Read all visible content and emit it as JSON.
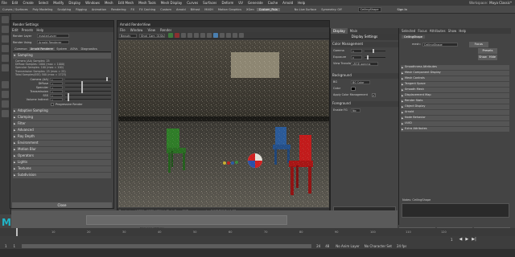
{
  "menubar": {
    "items": [
      "File",
      "Edit",
      "Create",
      "Select",
      "Modify",
      "Display",
      "Windows",
      "Mesh",
      "Edit Mesh",
      "Mesh Tools",
      "Mesh Display",
      "Curves",
      "Surfaces",
      "Deform",
      "UV",
      "Generate",
      "Cache",
      "Arnold",
      "Help"
    ],
    "object_field": "CeilingShape",
    "sign_in": "Sign In",
    "workspace_label": "Workspace:",
    "workspace_value": "Maya Classic*"
  },
  "shelf": {
    "tabs": [
      "Curves / Surfaces",
      "Poly Modeling",
      "Sculpting",
      "Rigging",
      "Animation",
      "Rendering",
      "FX",
      "FX Caching",
      "Custom",
      "Arnold",
      "Bifrost",
      "MASH",
      "Motion Graphics",
      "XGen",
      "Custom_Pola"
    ],
    "active_tab": "Custom_Pola",
    "live_surface": "No Live Surface",
    "symmetry": "Symmetry: Off"
  },
  "render_settings": {
    "title": "Render Settings",
    "menu": [
      "Edit",
      "Presets",
      "Help"
    ],
    "render_layer_label": "Render Layer",
    "render_layer_value": "masterLayer",
    "render_using_label": "Render Using",
    "render_using_value": "Arnold Renderer",
    "tabs": [
      "Common",
      "Arnold Renderer",
      "System",
      "AOVs",
      "Diagnostics"
    ],
    "sampling_section": "Sampling",
    "info_lines": [
      "Camera (AA) Samples: 25",
      "Diffuse Samples: 1000 (max = 1000)",
      "Specular Samples: 100 (max = 100)",
      "Transmission Samples: 25 (max = 25)",
      "Total Samples(SSS) 500 (max = 1723)"
    ],
    "sliders": [
      {
        "label": "Camera (AA)",
        "value": "5",
        "fill": 0.9
      },
      {
        "label": "Diffuse",
        "value": "2",
        "fill": 0.35
      },
      {
        "label": "Specular",
        "value": "2",
        "fill": 0.35
      },
      {
        "label": "Transmission",
        "value": "2",
        "fill": 0.35
      },
      {
        "label": "SSS",
        "value": "0",
        "fill": 0.05
      },
      {
        "label": "Volume Indirect",
        "value": "0",
        "fill": 0.05
      }
    ],
    "progressive_label": "Progressive Render",
    "sections": [
      "Adaptive Sampling",
      "Clamping",
      "Filter",
      "Advanced",
      "Ray Depth",
      "Environment",
      "Motion Blur",
      "Operators",
      "Lights",
      "Textures",
      "Subdivision"
    ],
    "close_label": "Close"
  },
  "render_view": {
    "title": "Arnold RenderView",
    "menu": [
      "File",
      "Window",
      "View",
      "Render"
    ],
    "camera": "Beauty",
    "shot_camera": "Shot_Cam_01Shape",
    "status": "Rendering | 1920×1080 (40%) | Shot_Cam_01Shape | samples 5/4/2/2/0/0 | 1:53"
  },
  "display_panel": {
    "tabs": [
      "Display",
      "Main"
    ],
    "active_tab": "Display",
    "header": "Display Settings",
    "color_mgmt": "Color Management",
    "gamma_label": "Gamma",
    "gamma_value": "1",
    "exposure_label": "Exposure",
    "exposure_value": "0",
    "view_transform_label": "View Transform",
    "view_transform_value": "sRGB gamma",
    "background_label": "Background",
    "bg_label": "BG",
    "bg_value": "BG Color",
    "color_label": "Color",
    "apply_cm_label": "Apply Color Management",
    "foreground_label": "Foreground",
    "enable_fg_label": "Enable FG",
    "enable_fg_value": "No"
  },
  "attribute_editor": {
    "tabs": [
      "Selected",
      "Focus",
      "Attributes",
      "Show",
      "Help"
    ],
    "node_name": "CeilingShape",
    "node_label": "mesh:",
    "node_field": "CeilingShape",
    "focus_label": "Focus",
    "presets_label": "Presets",
    "show_label": "Show",
    "hide_label": "Hide",
    "sections": [
      "Smoothness Attributes",
      "Mesh Component Display",
      "Mesh Controls",
      "Tangent Space",
      "Smooth Mesh",
      "Displacement Map",
      "Render Stats",
      "Object Display",
      "Arnold",
      "Node Behavior",
      "UUID",
      "Extra Attributes"
    ],
    "notes_label": "Notes: CeilingShape",
    "select_label": "Select",
    "load_label": "Load Attributes",
    "copy_label": "Copy Tab"
  },
  "timeline": {
    "ticks": [
      "1",
      "10",
      "20",
      "30",
      "40",
      "50",
      "60",
      "70",
      "80",
      "90",
      "100",
      "110",
      "120"
    ],
    "start": "1",
    "end": "120",
    "current": "1"
  },
  "range": {
    "start_a": "1",
    "start_b": "1",
    "end_a": "24",
    "end_b": "48",
    "layer": "No Anim Layer",
    "char": "No Character Set",
    "fps": "24 fps"
  },
  "colors": {
    "accent": "#4a7fb0",
    "chair_green": "#2f7d28",
    "chair_blue": "#2a5a99",
    "chair_red": "#c21b1b",
    "ball_red": "#d02020"
  }
}
